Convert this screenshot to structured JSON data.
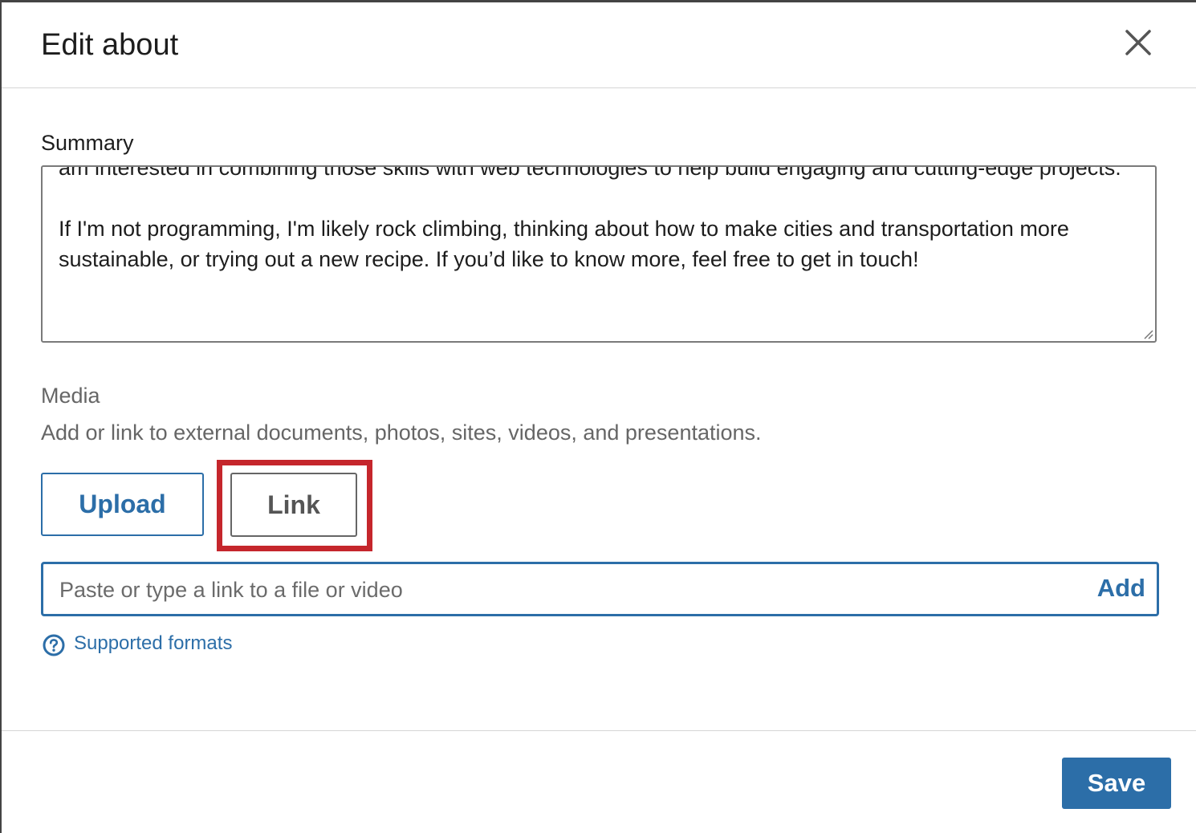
{
  "dialog": {
    "title": "Edit about",
    "close_icon": "close-icon"
  },
  "summary": {
    "label": "Summary",
    "text": "am interested in combining those skills with web technologies to help build engaging and cutting-edge projects.\n\nIf I'm not programming, I'm likely rock climbing, thinking about how to make cities and transportation more sustainable, or trying out a new recipe. If you’d like to know more, feel free to get in touch!"
  },
  "media": {
    "label": "Media",
    "description": "Add or link to external documents, photos, sites, videos, and presentations.",
    "upload_label": "Upload",
    "link_label": "Link",
    "link_input": {
      "value": "",
      "placeholder": "Paste or type a link to a file or video"
    },
    "add_label": "Add",
    "supported_formats": "Supported formats",
    "help_icon": "question-circle-icon"
  },
  "footer": {
    "save_label": "Save"
  },
  "colors": {
    "accent": "#2c6ea8",
    "highlight": "#c5262c",
    "text": "#1d1d1d",
    "muted": "#666666"
  }
}
